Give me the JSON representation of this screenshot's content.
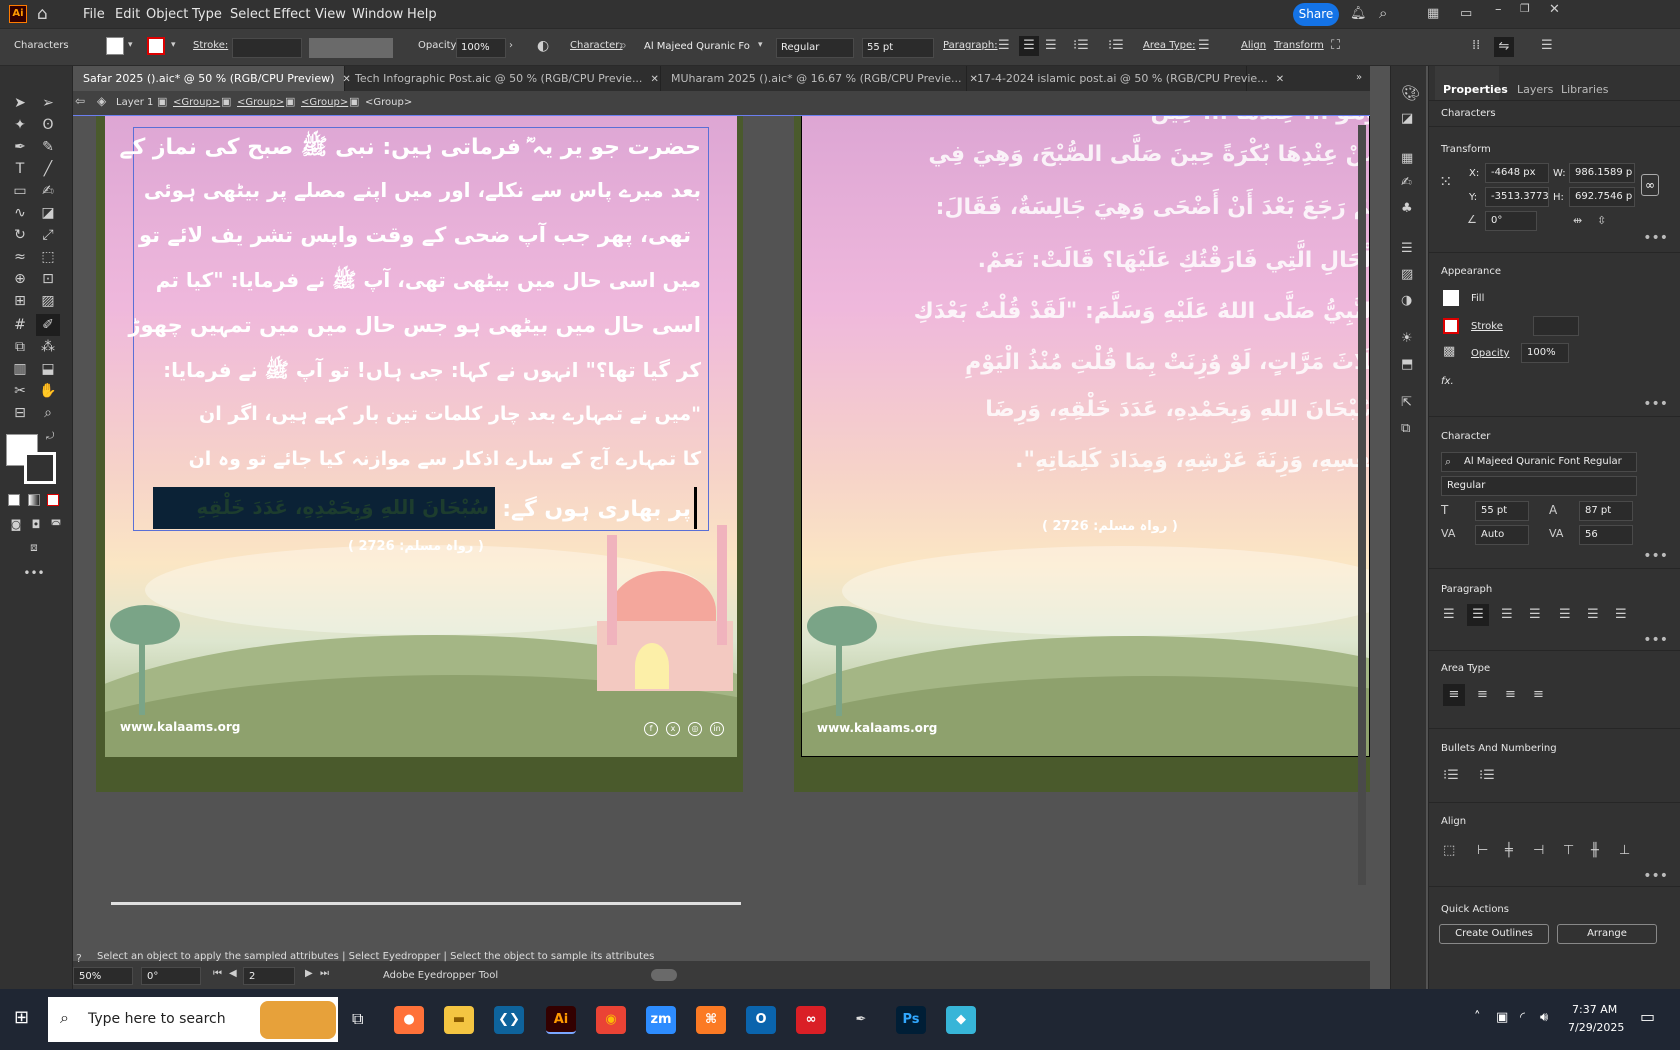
{
  "app": {
    "logo": "Ai",
    "menu": [
      "File",
      "Edit",
      "Object",
      "Type",
      "Select",
      "Effect",
      "View",
      "Window",
      "Help"
    ],
    "share_label": "Share"
  },
  "control_bar": {
    "panel_name": "Characters",
    "stroke_label": "Stroke:",
    "opacity_label": "Opacity:",
    "opacity_value": "100%",
    "character_label": "Character:",
    "font": "Al Majeed Quranic Font...",
    "style": "Regular",
    "size": "55 pt",
    "paragraph_label": "Paragraph:",
    "area_type_label": "Area Type:",
    "align_label": "Align",
    "transform_label": "Transform"
  },
  "tabs": [
    "Safar 2025 ().aic* @ 50 % (RGB/CPU Preview)",
    "Tech Infographic Post.aic @ 50 % (RGB/CPU Previe...",
    "MUharam 2025 ().aic* @ 16.67 % (RGB/CPU Previe...",
    "17-4-2024 islamic post.ai @ 50 % (RGB/CPU Previe..."
  ],
  "breadcrumb": [
    "Layer 1",
    "<Group>",
    "<Group>",
    "<Group>",
    "<Group>"
  ],
  "artboard_left": {
    "urdu_lines": [
      "حضرت جو یر یہ ؓ فرماتی ہیں: نبی ﷺ صبح کی نماز کے",
      "بعد میرے پاس سے نکلے، اور میں اپنے مصلے پر بیٹھی ہوئی",
      "تھی، پھر جب آپ ضحی کے وقت واپس تشر یف لائے تو",
      "میں اسی حال میں بیٹھی تھی، آپ ﷺ نے فرمایا: \"کیا تم",
      "اسی حال میں بیٹھی ہو جس حال میں میں تمہیں چھوڑ",
      "کر گیا تھا؟\" انہوں نے کہا: جی ہاں! تو آپ ﷺ نے فرمایا:",
      "\"میں نے تمہارے بعد چار کلمات تین بار کہے ہیں، اگر ان",
      "کا تمہارے آج کے سارے اذکار سے موازنہ کیا جائے تو وہ ان"
    ],
    "last_line_text": "پر بھاری ہوں گے:",
    "selected_arabic": "سُبْحَانَ اللهِ وَبِحَمْدِهِ، عَدَدَ خَلْقِهِ",
    "reference": "( رواہ مسلم: 2726 )",
    "website": "www.kalaams.org"
  },
  "artboard_right": {
    "arabic_lines": [
      "وَهُوَ ... عِنْدَهَا ... حِينَ",
      "مِنْ عِنْدِهَا بُكْرَةً حِينَ صَلَّى الصُّبْحَ، وَهِيَ فِي",
      "ثُمَّ رَجَعَ بَعْدَ أَنْ أَضْحَى وَهِيَ جَالِسَةٌ، فَقَالَ:",
      "الْحَالِ الَّتِي فَارَقْتُكِ عَلَيْهَا؟ قَالَتْ: نَعَمْ.",
      "النَّبِيُّ صَلَّى اللهُ عَلَيْهِ وَسَلَّمَ: \"لَقَدْ قُلْتُ بَعْدَكِ",
      "ثَلَاثَ مَرَّاتٍ، لَوْ وُزِنَتْ بِمَا قُلْتِ مُنْذُ الْيَوْمِ",
      "سُبْحَانَ اللهِ وَبِحَمْدِهِ، عَدَدَ خَلْقِهِ، وَرِضَا",
      "نَفْسِهِ، وَزِنَةَ عَرْشِهِ، وَمِدَادَ كَلِمَاتِهِ\"."
    ],
    "reference": "( رواہ مسلم: 2726 )",
    "website": "www.kalaams.org"
  },
  "status": {
    "hint": "Select an object to apply the sampled attributes  |  Select Eyedropper  |  Select the object to sample its attributes",
    "zoom": "50%",
    "rotation": "0°",
    "artboard_num": "2",
    "tool_name": "Adobe Eyedropper Tool"
  },
  "panel": {
    "tabs": [
      "Properties",
      "Layers",
      "Libraries"
    ],
    "section_title": "Characters",
    "transform": {
      "title": "Transform",
      "x_label": "X:",
      "x": "-4648 px",
      "y_label": "Y:",
      "y": "-3513.3773",
      "w_label": "W:",
      "w": "986.1589 p",
      "h_label": "H:",
      "h": "692.7546 p",
      "angle": "0°"
    },
    "appearance": {
      "title": "Appearance",
      "fill": "Fill",
      "stroke": "Stroke",
      "opacity": "Opacity",
      "opacity_value": "100%",
      "fx": "fx."
    },
    "character": {
      "title": "Character",
      "font": "Al Majeed Quranic Font Regular",
      "style": "Regular",
      "size": "55 pt",
      "leading": "87 pt",
      "kerning": "Auto",
      "tracking": "56"
    },
    "paragraph": {
      "title": "Paragraph"
    },
    "area_type": {
      "title": "Area Type"
    },
    "bullets": {
      "title": "Bullets And Numbering"
    },
    "align": {
      "title": "Align"
    },
    "quick_actions": {
      "title": "Quick Actions",
      "create_outlines": "Create Outlines",
      "arrange": "Arrange"
    }
  },
  "taskbar": {
    "search_placeholder": "Type here to search",
    "time": "7:37 AM",
    "date": "7/29/2025"
  }
}
